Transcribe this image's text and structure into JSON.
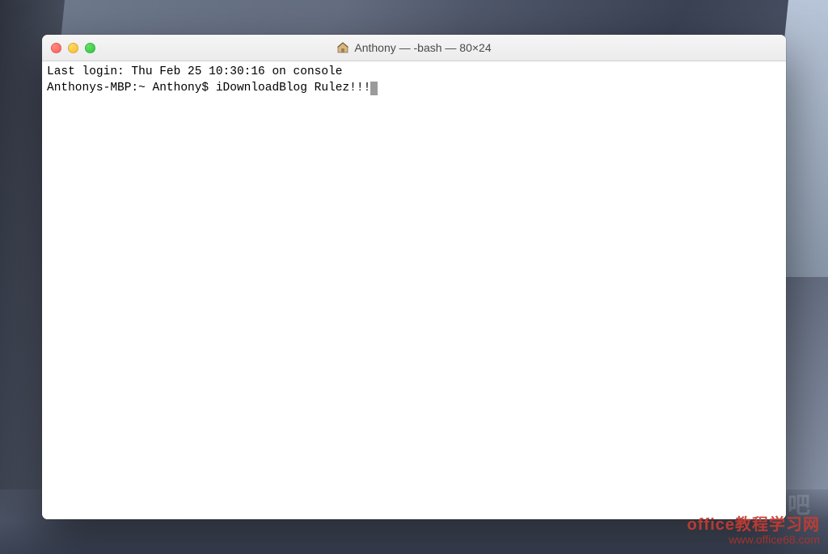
{
  "window": {
    "title": "Anthony — -bash — 80×24"
  },
  "terminal": {
    "last_login_line": "Last login: Thu Feb 25 10:30:16 on console",
    "prompt": "Anthonys-MBP:~ Anthony$ ",
    "command": "iDownloadBlog Rulez!!!"
  },
  "watermark": {
    "faded": "下载吧",
    "line1": "office教程学习网",
    "line2": "www.office68.com"
  }
}
